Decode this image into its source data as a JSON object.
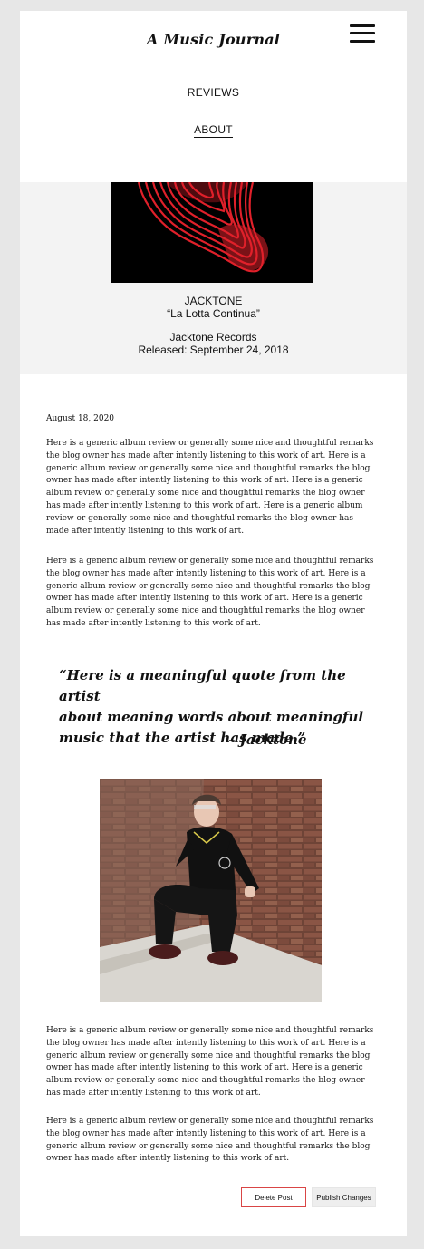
{
  "header": {
    "title": "A Music Journal"
  },
  "nav": {
    "items": [
      {
        "label": "REVIEWS"
      },
      {
        "label": "ABOUT"
      }
    ]
  },
  "album": {
    "artist": "JACKTONE",
    "title": "“La Lotta Continua”",
    "label": "Jacktone Records",
    "release": "Released: September 24, 2018"
  },
  "post": {
    "date": "August 18, 2020",
    "paragraphs": [
      "Here is a generic album review or generally some nice and thoughtful remarks\nthe blog owner has made after intently listening to this work of art. Here is a\ngeneric album review or generally some nice and thoughtful remarks the blog\nowner has made after intently listening to this work of art. Here is a generic\nalbum review or generally some nice and thoughtful remarks the blog owner\nhas made after intently listening to this work of art. Here is a generic album\nreview or generally some nice and thoughtful remarks the blog owner has\nmade after intently listening to this work of art.",
      "Here is a generic album review or generally some nice and thoughtful remarks\nthe blog owner has made after intently listening to this work of art. Here is a\ngeneric album review or generally some nice and thoughtful remarks the blog\nowner has made after intently listening to this work of art. Here is a generic\nalbum review or generally some nice and thoughtful remarks the blog owner\nhas made after intently listening to this work of art.",
      "Here is a generic album review or generally some nice and thoughtful remarks\nthe blog owner has made after intently listening to this work of art. Here is a\ngeneric album review or generally some nice and thoughtful remarks the blog\nowner has made after intently listening to this work of art. Here is a generic\nalbum review or generally some nice and thoughtful remarks the blog owner\nhas made after intently listening to this work of art.",
      "Here is a generic album review or generally some nice and thoughtful remarks\nthe blog owner has made after intently listening to this work of art. Here is a\ngeneric album review or generally some nice and thoughtful remarks the blog\nowner has made after intently listening to this work of art."
    ],
    "quote": "“Here is a meaningful quote from the artist\nabout meaning words about meaningful\nmusic that the artist has made.”",
    "quote_attribution": "– Jacktone"
  },
  "actions": {
    "delete_label": "Delete Post",
    "publish_label": "Publish Changes"
  },
  "colors": {
    "page_bg": "#e7e7e7",
    "album_band": "#f3f3f3",
    "art_red": "#e0202a",
    "delete_border": "#d94545"
  },
  "icons": {
    "menu": "hamburger-menu-icon"
  }
}
